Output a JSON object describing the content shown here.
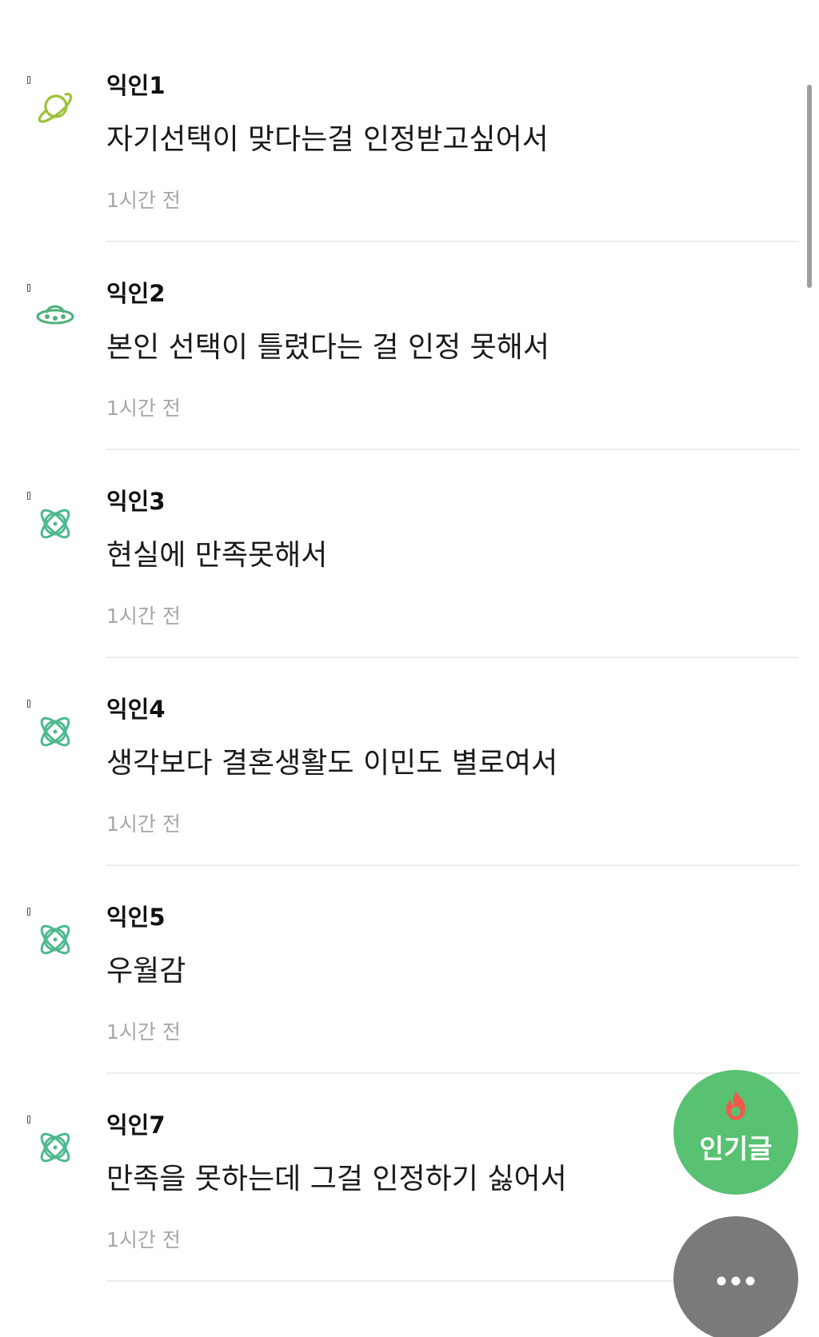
{
  "comments": [
    {
      "nickname": "익인1",
      "text": "자기선택이 맞다는걸 인정받고싶어서",
      "time": "1시간 전",
      "avatar_icon": "planet-icon",
      "avatar_color": "#9cc23b"
    },
    {
      "nickname": "익인2",
      "text": "본인 선택이 틀렸다는 걸 인정 못해서",
      "time": "1시간 전",
      "avatar_icon": "ufo-icon",
      "avatar_color": "#4fb07a"
    },
    {
      "nickname": "익인3",
      "text": "현실에 만족못해서",
      "time": "1시간 전",
      "avatar_icon": "atom-icon",
      "avatar_color": "#4fb98e"
    },
    {
      "nickname": "익인4",
      "text": "생각보다 결혼생활도 이민도 별로여서",
      "time": "1시간 전",
      "avatar_icon": "atom-icon",
      "avatar_color": "#4fb98e"
    },
    {
      "nickname": "익인5",
      "text": "우월감",
      "time": "1시간 전",
      "avatar_icon": "atom-icon",
      "avatar_color": "#4fb98e"
    },
    {
      "nickname": "익인7",
      "text": "만족을 못하는데 그걸 인정하기 싫어서",
      "time": "1시간 전",
      "avatar_icon": "atom-icon",
      "avatar_color": "#4fb98e"
    }
  ],
  "fab": {
    "popular_label": "인기글",
    "popular_icon": "flame-icon",
    "popular_color": "#58c172",
    "more_icon": "more-dots-icon",
    "more_color": "#7a7a7a"
  }
}
